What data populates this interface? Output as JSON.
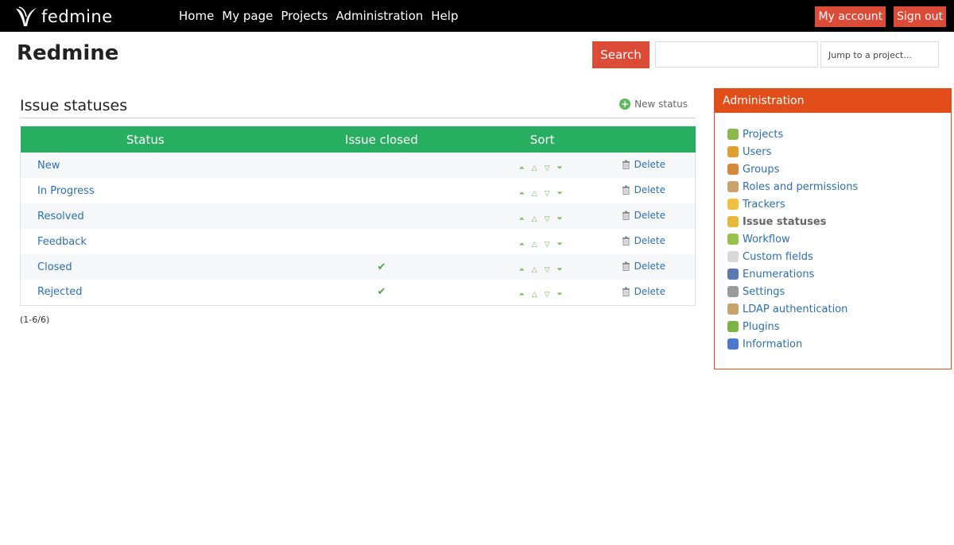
{
  "top_menu": {
    "logo_text": "fedmine",
    "nav": [
      "Home",
      "My page",
      "Projects",
      "Administration",
      "Help"
    ],
    "account": [
      "My account",
      "Sign out"
    ],
    "account_color": "#dc4a38"
  },
  "header": {
    "title": "Redmine",
    "search_label": "Search",
    "search_value": "",
    "jump_placeholder": "Jump to a project..."
  },
  "content": {
    "title": "Issue statuses",
    "new_status_label": "New status",
    "table": {
      "headers": [
        "Status",
        "Issue closed",
        "Sort",
        ""
      ],
      "header_color": "#27ae60",
      "rows": [
        {
          "name": "New",
          "closed": "",
          "delete": "Delete"
        },
        {
          "name": "In Progress",
          "closed": "",
          "delete": "Delete"
        },
        {
          "name": "Resolved",
          "closed": "",
          "delete": "Delete"
        },
        {
          "name": "Feedback",
          "closed": "",
          "delete": "Delete"
        },
        {
          "name": "Closed",
          "closed": "✔",
          "delete": "Delete"
        },
        {
          "name": "Rejected",
          "closed": "✔",
          "delete": "Delete"
        }
      ]
    },
    "pagination": "(1-6/6)"
  },
  "sidebar": {
    "title": "Administration",
    "accent": "#e14e1a",
    "items": [
      {
        "label": "Projects",
        "icon": "projects-icon",
        "color": "#8ab84a",
        "selected": false
      },
      {
        "label": "Users",
        "icon": "user-icon",
        "color": "#e0a030",
        "selected": false
      },
      {
        "label": "Groups",
        "icon": "group-icon",
        "color": "#d6883a",
        "selected": false
      },
      {
        "label": "Roles and permissions",
        "icon": "roles-icon",
        "color": "#c9a36a",
        "selected": false
      },
      {
        "label": "Trackers",
        "icon": "tracker-icon",
        "color": "#f0c040",
        "selected": false
      },
      {
        "label": "Issue statuses",
        "icon": "issue-status-icon",
        "color": "#e8b83a",
        "selected": true
      },
      {
        "label": "Workflow",
        "icon": "workflow-icon",
        "color": "#9ac24a",
        "selected": false
      },
      {
        "label": "Custom fields",
        "icon": "custom-fields-icon",
        "color": "#d8d8d8",
        "selected": false
      },
      {
        "label": "Enumerations",
        "icon": "list-icon",
        "color": "#5a7ab0",
        "selected": false
      },
      {
        "label": "Settings",
        "icon": "gear-icon",
        "color": "#9a9a9a",
        "selected": false
      },
      {
        "label": "LDAP authentication",
        "icon": "ldap-icon",
        "color": "#c9a36a",
        "selected": false
      },
      {
        "label": "Plugins",
        "icon": "plugin-icon",
        "color": "#7cb342",
        "selected": false
      },
      {
        "label": "Information",
        "icon": "info-icon",
        "color": "#4a7ad0",
        "selected": false
      }
    ]
  }
}
